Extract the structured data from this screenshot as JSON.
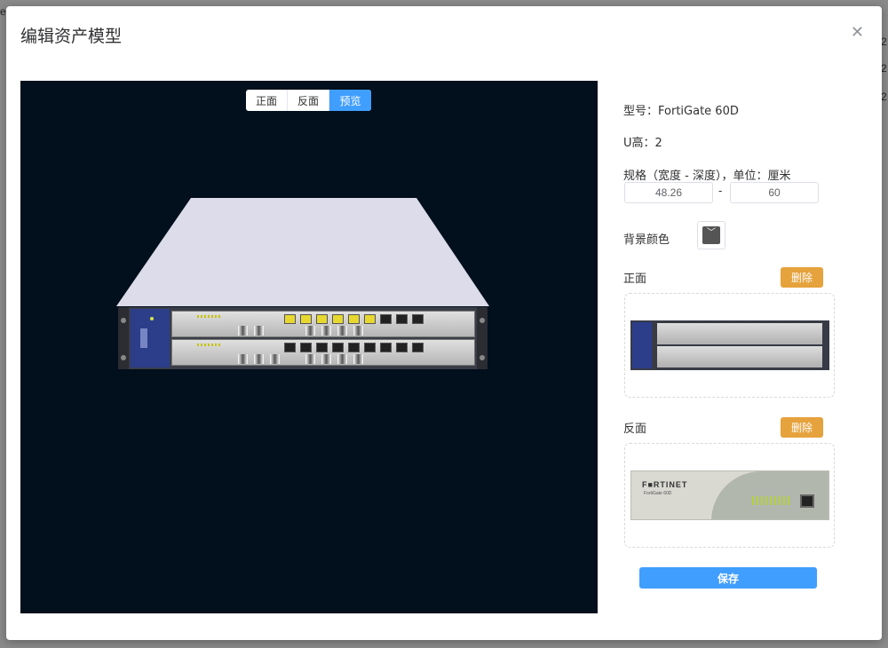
{
  "background": {
    "fragments": [
      "e",
      "2",
      "2",
      "2"
    ]
  },
  "modal": {
    "title": "编辑资产模型",
    "close_icon": "close-icon"
  },
  "viewer": {
    "tabs": [
      {
        "label": "正面",
        "active": false
      },
      {
        "label": "反面",
        "active": false
      },
      {
        "label": "预览",
        "active": true
      }
    ],
    "device_colors": {
      "top": "#dcdcea",
      "brand_panel": "#2c3e8a",
      "port_yellow": "#e7d830"
    }
  },
  "form": {
    "model_label": "型号：",
    "model_value": "FortiGate 60D",
    "u_height_label": "U高：",
    "u_height_value": "2",
    "spec_label": "规格（宽度 - 深度），单位：厘米",
    "width_value": "48.26",
    "dim_separator": "-",
    "depth_value": "60",
    "bg_color_label": "背景颜色",
    "bg_color_value": "#555555",
    "front_label": "正面",
    "front_delete": "删除",
    "back_label": "反面",
    "back_delete": "删除",
    "back_brand": "F■RTINET",
    "back_model": "FortiGate 60D",
    "save_label": "保存"
  },
  "colors": {
    "primary": "#409eff",
    "warning": "#e6a23c",
    "viewer_bg": "#020f1c"
  }
}
